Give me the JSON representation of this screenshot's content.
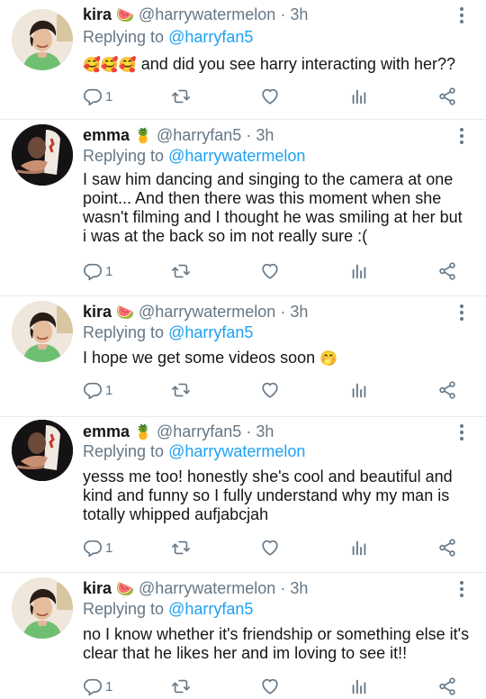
{
  "colors": {
    "link": "#1da1f2",
    "muted": "#657786",
    "text": "#14171a",
    "divider": "#e6ecf0"
  },
  "icons": [
    "reply-icon",
    "retweet-icon",
    "like-icon",
    "analytics-icon",
    "share-icon",
    "more-icon"
  ],
  "tweets": [
    {
      "name": "kira",
      "name_emoji": "🍉",
      "handle": "@harrywatermelon",
      "dot": "·",
      "time": "3h",
      "reply_prefix": "Replying to",
      "reply_to": "@harryfan5",
      "lead_emoji": "🥰🥰🥰",
      "text": "and did you see harry interacting with her??",
      "reply_count": "1"
    },
    {
      "name": "emma",
      "name_emoji": "🍍",
      "handle": "@harryfan5",
      "dot": "·",
      "time": "3h",
      "reply_prefix": "Replying to",
      "reply_to": "@harrywatermelon",
      "text": "I saw him dancing and singing to the camera at one point... And then there was this moment when she wasn't filming and I thought he was smiling at her but i was at the back so im not really sure :(",
      "reply_count": "1"
    },
    {
      "name": "kira",
      "name_emoji": "🍉",
      "handle": "@harrywatermelon",
      "dot": "·",
      "time": "3h",
      "reply_prefix": "Replying to",
      "reply_to": "@harryfan5",
      "text": "I hope we get some videos soon",
      "trail_emoji": "🤭",
      "reply_count": "1"
    },
    {
      "name": "emma",
      "name_emoji": "🍍",
      "handle": "@harryfan5",
      "dot": "·",
      "time": "3h",
      "reply_prefix": "Replying to",
      "reply_to": "@harrywatermelon",
      "text": "yesss me too! honestly she's cool and beautiful and kind and funny so I fully understand why my man is totally whipped aufjabcjah",
      "reply_count": "1"
    },
    {
      "name": "kira",
      "name_emoji": "🍉",
      "handle": "@harrywatermelon",
      "dot": "·",
      "time": "3h",
      "reply_prefix": "Replying to",
      "reply_to": "@harryfan5",
      "text": "no I know whether it's friendship or something else it's clear that he likes her and im loving to see it!!",
      "reply_count": "1"
    }
  ]
}
